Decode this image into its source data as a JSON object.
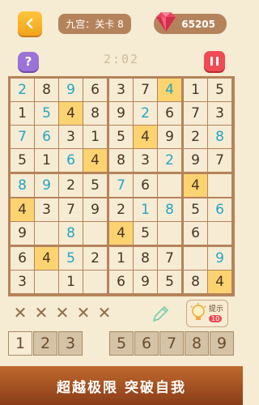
{
  "header": {
    "level_label": "九宫：关卡 8",
    "coins": "65205",
    "back_icon": "back-arrow-icon",
    "gem_icon": "ruby-gem-icon"
  },
  "toolbar": {
    "help_label": "?",
    "timer": "2:02",
    "pause_icon": "pause-icon"
  },
  "colors": {
    "board_border": "#b5835b",
    "cell_bg": "#f6ebd3",
    "highlight_bg": "#fbd371",
    "given_digit": "#4a3424",
    "entered_digit": "#21a6c6"
  },
  "board": {
    "rows": [
      [
        {
          "v": "2",
          "c": "e"
        },
        {
          "v": "8",
          "c": "g"
        },
        {
          "v": "9",
          "c": "e"
        },
        {
          "v": "6",
          "c": "g"
        },
        {
          "v": "3",
          "c": "g"
        },
        {
          "v": "7",
          "c": "g"
        },
        {
          "v": "4",
          "c": "e",
          "h": 1
        },
        {
          "v": "1",
          "c": "g"
        },
        {
          "v": "5",
          "c": "g"
        }
      ],
      [
        {
          "v": "1",
          "c": "g"
        },
        {
          "v": "5",
          "c": "e"
        },
        {
          "v": "4",
          "c": "g",
          "h": 1
        },
        {
          "v": "8",
          "c": "g"
        },
        {
          "v": "9",
          "c": "g"
        },
        {
          "v": "2",
          "c": "e"
        },
        {
          "v": "6",
          "c": "g"
        },
        {
          "v": "7",
          "c": "g"
        },
        {
          "v": "3",
          "c": "g"
        }
      ],
      [
        {
          "v": "7",
          "c": "e"
        },
        {
          "v": "6",
          "c": "e"
        },
        {
          "v": "3",
          "c": "g"
        },
        {
          "v": "1",
          "c": "g"
        },
        {
          "v": "5",
          "c": "g"
        },
        {
          "v": "4",
          "c": "g",
          "h": 1
        },
        {
          "v": "9",
          "c": "g"
        },
        {
          "v": "2",
          "c": "g"
        },
        {
          "v": "8",
          "c": "e"
        }
      ],
      [
        {
          "v": "5",
          "c": "g"
        },
        {
          "v": "1",
          "c": "g"
        },
        {
          "v": "6",
          "c": "e"
        },
        {
          "v": "4",
          "c": "g",
          "h": 1
        },
        {
          "v": "8",
          "c": "g"
        },
        {
          "v": "3",
          "c": "g"
        },
        {
          "v": "2",
          "c": "e"
        },
        {
          "v": "9",
          "c": "g"
        },
        {
          "v": "7",
          "c": "g"
        }
      ],
      [
        {
          "v": "8",
          "c": "e"
        },
        {
          "v": "9",
          "c": "e"
        },
        {
          "v": "2",
          "c": "g"
        },
        {
          "v": "5",
          "c": "g"
        },
        {
          "v": "7",
          "c": "e"
        },
        {
          "v": "6",
          "c": "g"
        },
        {
          "v": "",
          "c": "g"
        },
        {
          "v": "4",
          "c": "g",
          "h": 1
        },
        {
          "v": "",
          "c": "g"
        }
      ],
      [
        {
          "v": "4",
          "c": "g",
          "h": 1
        },
        {
          "v": "3",
          "c": "g"
        },
        {
          "v": "7",
          "c": "g"
        },
        {
          "v": "9",
          "c": "g"
        },
        {
          "v": "2",
          "c": "g"
        },
        {
          "v": "1",
          "c": "e"
        },
        {
          "v": "8",
          "c": "e"
        },
        {
          "v": "5",
          "c": "g"
        },
        {
          "v": "6",
          "c": "e"
        }
      ],
      [
        {
          "v": "9",
          "c": "g"
        },
        {
          "v": "",
          "c": "g"
        },
        {
          "v": "8",
          "c": "e"
        },
        {
          "v": "",
          "c": "g"
        },
        {
          "v": "4",
          "c": "g",
          "h": 1
        },
        {
          "v": "5",
          "c": "g"
        },
        {
          "v": "",
          "c": "g"
        },
        {
          "v": "6",
          "c": "g"
        },
        {
          "v": "",
          "c": "g"
        }
      ],
      [
        {
          "v": "6",
          "c": "g"
        },
        {
          "v": "4",
          "c": "g",
          "h": 1
        },
        {
          "v": "5",
          "c": "e"
        },
        {
          "v": "2",
          "c": "g"
        },
        {
          "v": "1",
          "c": "g"
        },
        {
          "v": "8",
          "c": "g"
        },
        {
          "v": "7",
          "c": "g"
        },
        {
          "v": "",
          "c": "g"
        },
        {
          "v": "9",
          "c": "e"
        }
      ],
      [
        {
          "v": "3",
          "c": "g"
        },
        {
          "v": "",
          "c": "g"
        },
        {
          "v": "1",
          "c": "g"
        },
        {
          "v": "",
          "c": "g"
        },
        {
          "v": "6",
          "c": "g"
        },
        {
          "v": "9",
          "c": "g"
        },
        {
          "v": "5",
          "c": "g"
        },
        {
          "v": "8",
          "c": "g"
        },
        {
          "v": "4",
          "c": "g",
          "h": 1
        }
      ]
    ]
  },
  "mistakes": {
    "marks": [
      "✕",
      "✕",
      "✕",
      "✕",
      "✕"
    ],
    "icon": "cross-icon"
  },
  "tools": {
    "pencil_icon": "pencil-icon",
    "hint_label": "提示",
    "hint_count": "10",
    "hint_icon": "lightbulb-icon"
  },
  "digits": {
    "left": [
      "1",
      "2",
      "3"
    ],
    "right": [
      "5",
      "6",
      "7",
      "8",
      "9"
    ]
  },
  "banner": {
    "text": "超越极限  突破自我"
  }
}
